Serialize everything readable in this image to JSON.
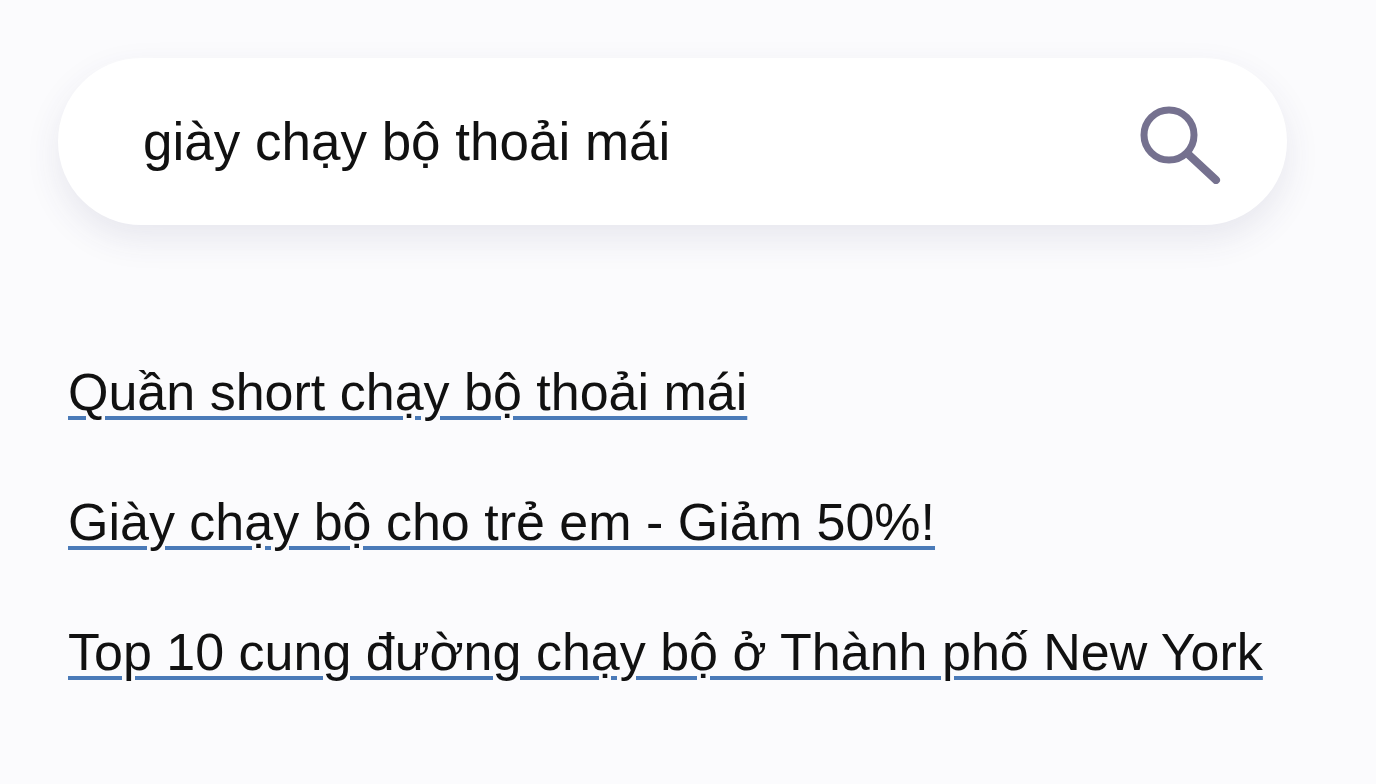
{
  "search": {
    "value": "giày chạy bộ thoải mái"
  },
  "results": [
    {
      "text": "Quần short chạy bộ thoải mái"
    },
    {
      "text": "Giày chạy bộ cho trẻ em - Giảm 50%!"
    },
    {
      "text": "Top 10 cung đường chạy bộ ở Thành phố New York"
    }
  ]
}
